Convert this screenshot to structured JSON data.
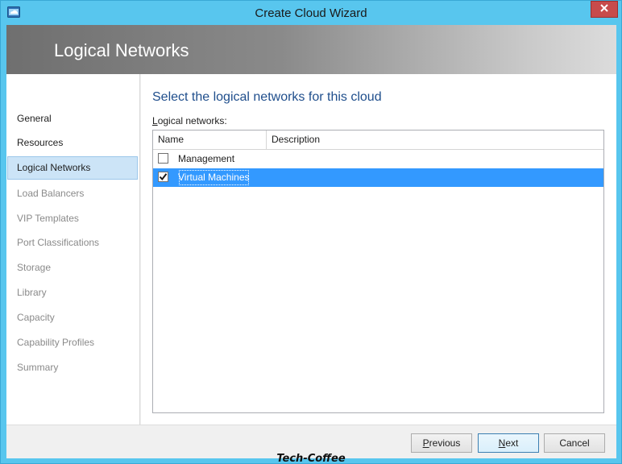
{
  "window": {
    "title": "Create Cloud Wizard"
  },
  "banner": {
    "title": "Logical Networks"
  },
  "nav": {
    "items": [
      {
        "label": "General",
        "state": "done"
      },
      {
        "label": "Resources",
        "state": "done"
      },
      {
        "label": "Logical Networks",
        "state": "active"
      },
      {
        "label": "Load Balancers",
        "state": "pending"
      },
      {
        "label": "VIP Templates",
        "state": "pending"
      },
      {
        "label": "Port Classifications",
        "state": "pending"
      },
      {
        "label": "Storage",
        "state": "pending"
      },
      {
        "label": "Library",
        "state": "pending"
      },
      {
        "label": "Capacity",
        "state": "pending"
      },
      {
        "label": "Capability Profiles",
        "state": "pending"
      },
      {
        "label": "Summary",
        "state": "pending"
      }
    ]
  },
  "content": {
    "heading": "Select the logical networks for this cloud",
    "list_label_accel": "L",
    "list_label_rest": "ogical networks:",
    "columns": [
      "Name",
      "Description"
    ],
    "rows": [
      {
        "name": "Management",
        "description": "",
        "checked": false,
        "selected": false
      },
      {
        "name": "Virtual Machines",
        "description": "",
        "checked": true,
        "selected": true
      }
    ]
  },
  "footer": {
    "previous_accel": "P",
    "previous_rest": "revious",
    "next_accel": "N",
    "next_rest": "ext",
    "cancel": "Cancel"
  },
  "watermark": "Tech-Coffee",
  "colors": {
    "accent": "#58c6ee",
    "selection": "#3399ff",
    "heading": "#1f4e8c",
    "close": "#c74b4b"
  },
  "icons": {
    "app": "cloud-wizard-icon",
    "close": "close-icon",
    "checkbox": "checkbox-icon"
  }
}
